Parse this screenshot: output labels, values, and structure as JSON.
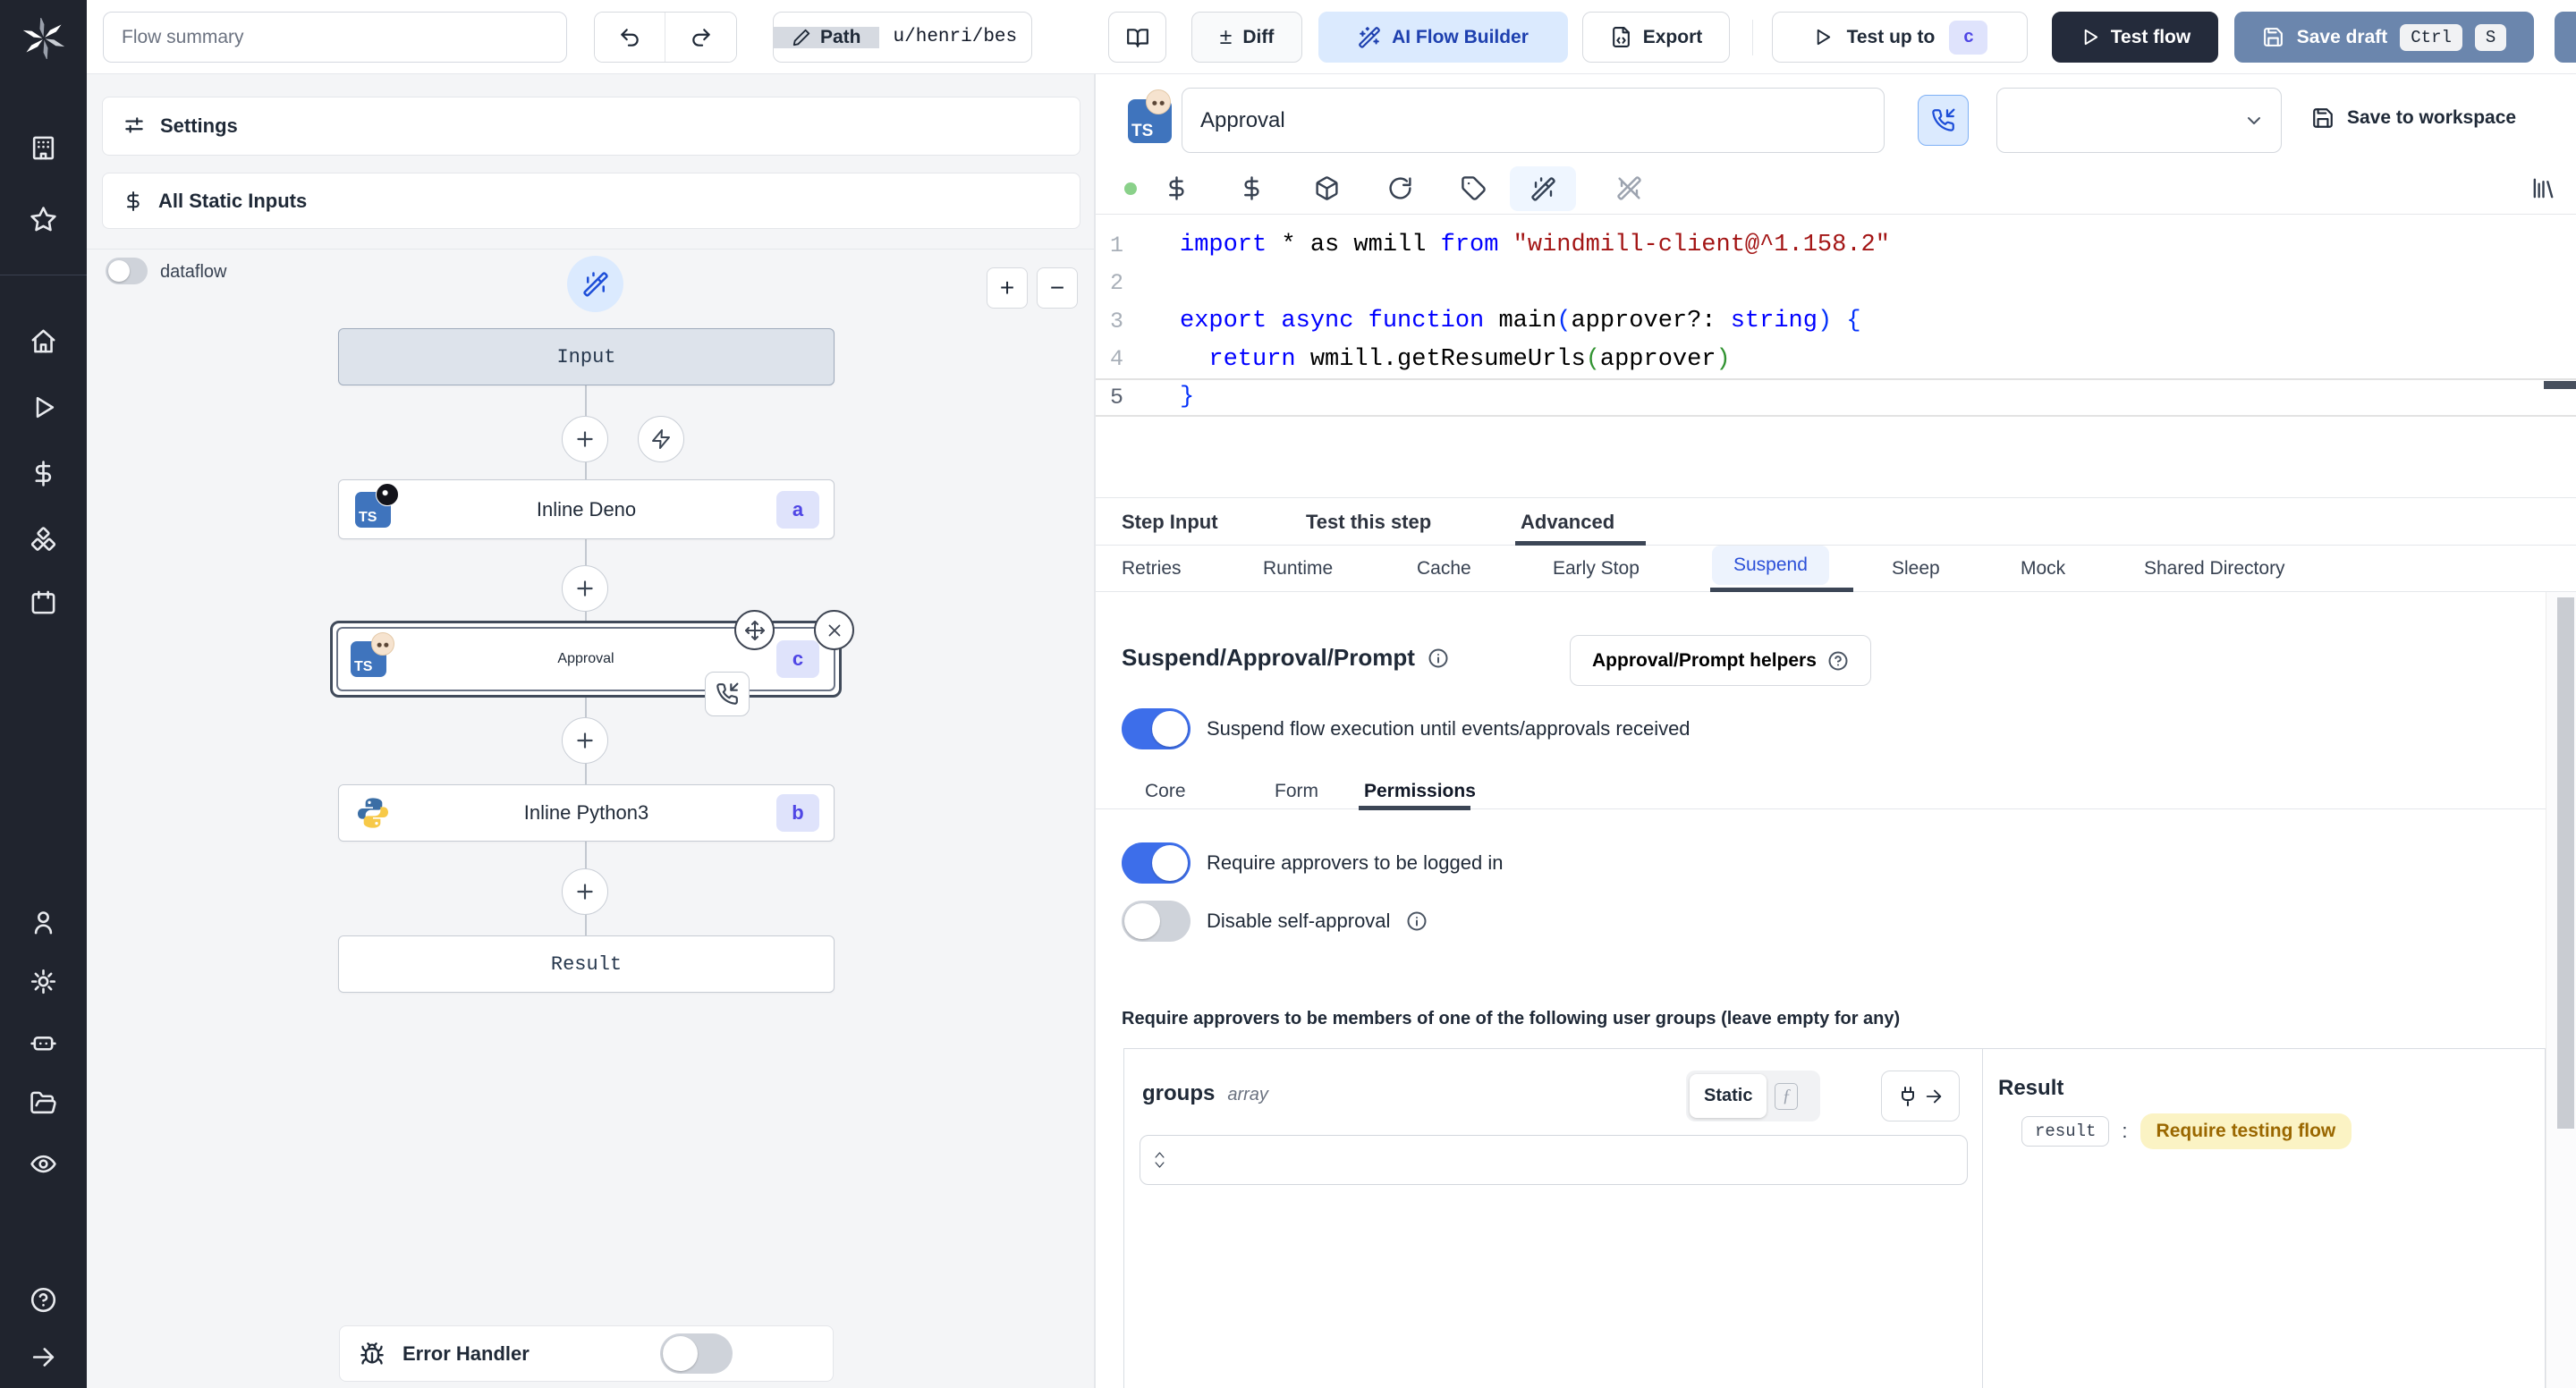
{
  "topbar": {
    "flow_summary_placeholder": "Flow summary",
    "path_label": "Path",
    "path_value": "u/henri/bes",
    "diff_symbol": "±",
    "diff_label": "Diff",
    "ai_flow_builder_label": "AI Flow Builder",
    "export_label": "Export",
    "test_up_to_label": "Test up to",
    "test_up_to_badge": "c",
    "test_flow_label": "Test flow",
    "save_draft_label": "Save draft",
    "shortcut": {
      "ctrl": "Ctrl",
      "key": "S"
    }
  },
  "icons": {
    "ts_label": "TS",
    "fn_label": "ƒ"
  },
  "flow_panel": {
    "settings_label": "Settings",
    "static_inputs_label": "All Static Inputs",
    "dataflow_label": "dataflow",
    "zoom_in_label": "+",
    "zoom_out_label": "−",
    "error_handler_label": "Error Handler",
    "nodes": {
      "input": {
        "label": "Input"
      },
      "deno": {
        "label": "Inline Deno",
        "badge": "a"
      },
      "approval": {
        "label": "Approval",
        "badge": "c"
      },
      "python": {
        "label": "Inline Python3",
        "badge": "b"
      },
      "result": {
        "label": "Result"
      }
    }
  },
  "step_panel": {
    "title_value": "Approval",
    "save_to_workspace_label": "Save to workspace",
    "code": {
      "lines": [
        [
          [
            "kw",
            "import"
          ],
          [
            "pl",
            " * as wmill "
          ],
          [
            "kw",
            "from"
          ],
          [
            "pl",
            " "
          ],
          [
            "str",
            "\"windmill-client@^1.158.2\""
          ]
        ],
        [],
        [
          [
            "kw",
            "export"
          ],
          [
            "pl",
            " "
          ],
          [
            "kw",
            "async"
          ],
          [
            "pl",
            " "
          ],
          [
            "kw",
            "function"
          ],
          [
            "pl",
            " main"
          ],
          [
            "b1",
            "("
          ],
          [
            "pl",
            "approver?: "
          ],
          [
            "kw",
            "string"
          ],
          [
            "b1",
            ")"
          ],
          [
            "pl",
            " "
          ],
          [
            "b1",
            "{"
          ]
        ],
        [
          [
            "pl",
            "  "
          ],
          [
            "kw",
            "return"
          ],
          [
            "pl",
            " wmill.getResumeUrls"
          ],
          [
            "b2",
            "("
          ],
          [
            "pl",
            "approver"
          ],
          [
            "b2",
            ")"
          ]
        ],
        [
          [
            "b1",
            "}"
          ]
        ]
      ]
    },
    "tabs": {
      "step_input": "Step Input",
      "test_this_step": "Test this step",
      "advanced": "Advanced"
    },
    "advanced_tabs": [
      "Retries",
      "Runtime",
      "Cache",
      "Early Stop",
      "Suspend",
      "Sleep",
      "Mock",
      "Shared Directory"
    ],
    "suspend": {
      "heading": "Suspend/Approval/Prompt",
      "helpers_label": "Approval/Prompt helpers",
      "toggle_label": "Suspend flow execution until events/approvals received",
      "sub_tabs": [
        "Core",
        "Form",
        "Permissions"
      ],
      "require_login_label": "Require approvers to be logged in",
      "disable_self_approval_label": "Disable self-approval",
      "groups_note": "Require approvers to be members of one of the following user groups (leave empty for any)",
      "groups_field": {
        "name": "groups",
        "type": "array",
        "static_label": "Static"
      }
    },
    "result": {
      "heading": "Result",
      "key": "result",
      "separator": ":",
      "value": "Require testing flow"
    }
  }
}
